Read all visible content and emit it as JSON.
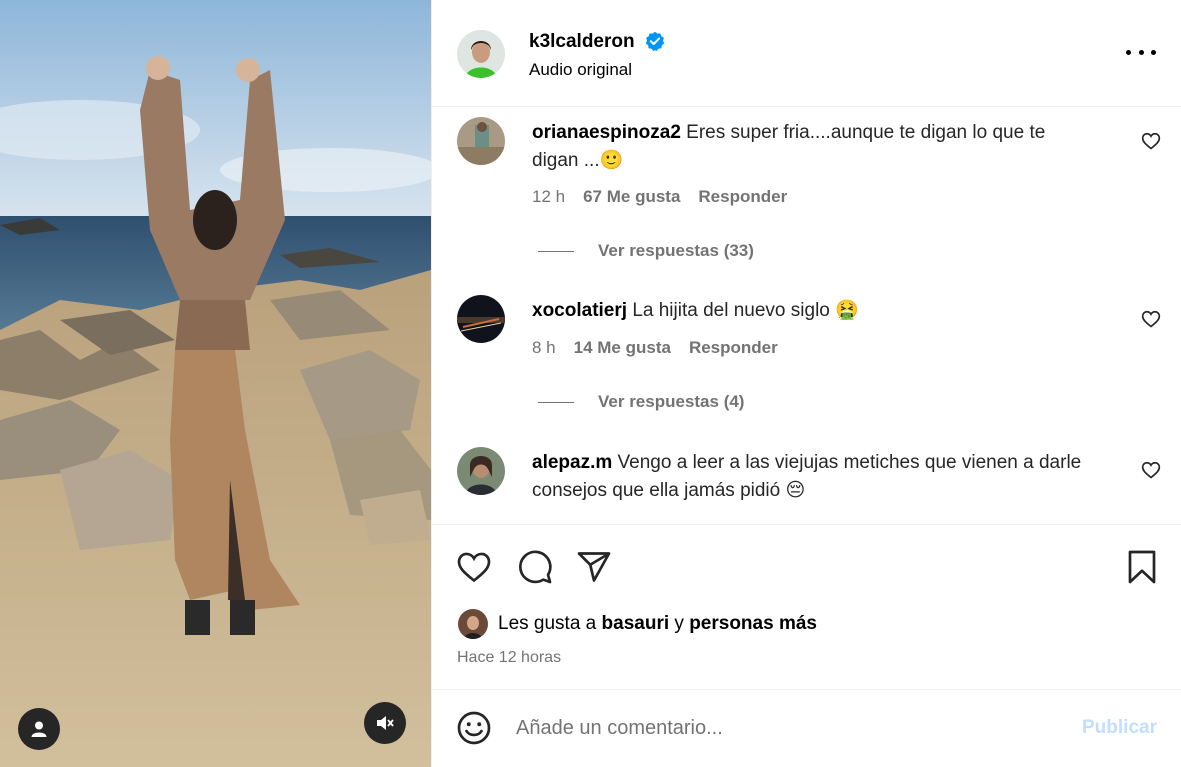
{
  "post": {
    "author": "k3lcalderon",
    "verified": true,
    "audio": "Audio original",
    "menu_icon": "more-horizontal-icon"
  },
  "comments": [
    {
      "user": "orianaespinoza2",
      "text": "Eres super fria....aunque te digan lo que te digan ...🙂",
      "time": "12 h",
      "likes": "67 Me gusta",
      "reply": "Responder",
      "view_replies": "Ver respuestas (33)"
    },
    {
      "user": "xocolatierj",
      "text": "La hijita del nuevo siglo 🤮",
      "time": "8 h",
      "likes": "14 Me gusta",
      "reply": "Responder",
      "view_replies": "Ver respuestas (4)"
    },
    {
      "user": "alepaz.m",
      "text": "Vengo a leer a las viejujas metiches que vienen a darle consejos que ella jamás pidió 😔"
    }
  ],
  "likes_summary": {
    "prefix": "Les gusta a",
    "user": "basauri",
    "connector": "y",
    "others": "personas más"
  },
  "time_ago": "Hace 12 horas",
  "comment_box": {
    "placeholder": "Añade un comentario...",
    "publish_label": "Publicar"
  },
  "colors": {
    "link_blue": "#0095f6",
    "publish_disabled": "#c0dffd",
    "muted_text": "#737373",
    "border": "#efefef"
  }
}
